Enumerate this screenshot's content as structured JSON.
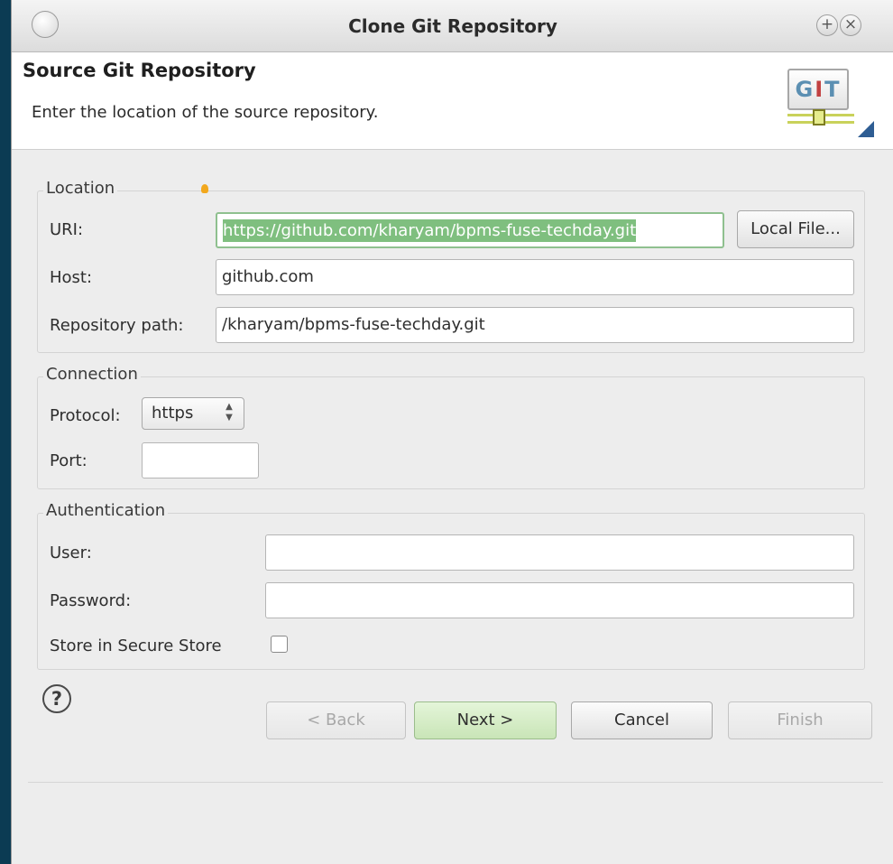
{
  "window": {
    "title": "Clone Git Repository",
    "maximize_glyph": "+",
    "close_glyph": "×"
  },
  "header": {
    "title": "Source Git Repository",
    "description": "Enter the location of the source repository.",
    "logo_text_g": "G",
    "logo_text_i": "I",
    "logo_text_t": "T"
  },
  "location": {
    "legend": "Location",
    "uri_label": "URI:",
    "uri_value": "https://github.com/kharyam/bpms-fuse-techday.git",
    "local_file_button": "Local File...",
    "host_label": "Host:",
    "host_value": "github.com",
    "repo_path_label": "Repository path:",
    "repo_path_value": "/kharyam/bpms-fuse-techday.git"
  },
  "connection": {
    "legend": "Connection",
    "protocol_label": "Protocol:",
    "protocol_value": "https",
    "port_label": "Port:",
    "port_value": ""
  },
  "authentication": {
    "legend": "Authentication",
    "user_label": "User:",
    "user_value": "",
    "password_label": "Password:",
    "password_value": "",
    "store_label": "Store in Secure Store",
    "store_checked": false
  },
  "footer": {
    "help_glyph": "?",
    "back_button": "< Back",
    "next_button": "Next >",
    "cancel_button": "Cancel",
    "finish_button": "Finish"
  },
  "colors": {
    "desktop_bg": "#0b3b53",
    "selection_green": "#7fbf7f",
    "default_button": "#c9e5b7"
  }
}
